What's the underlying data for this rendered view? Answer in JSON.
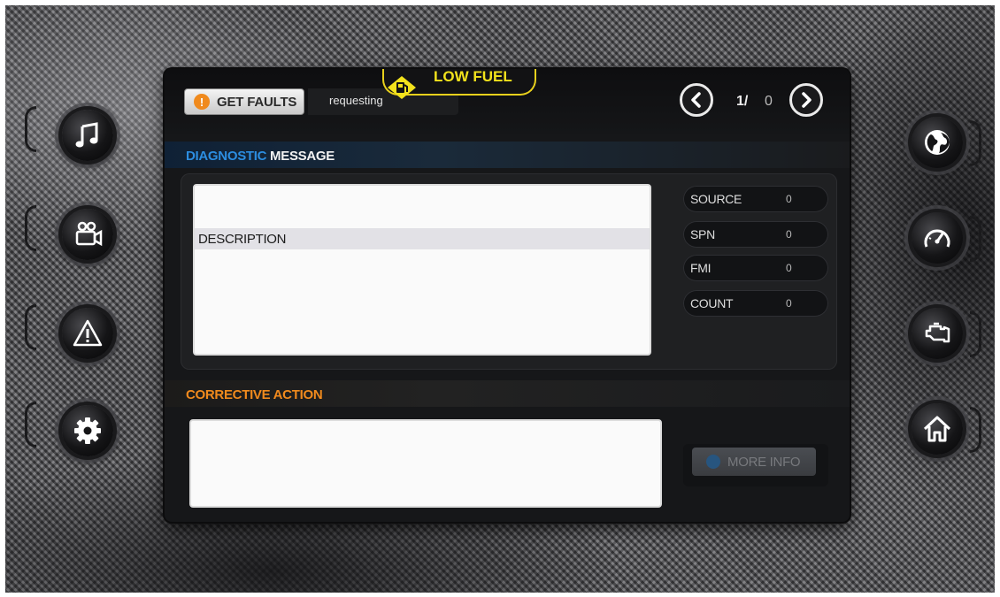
{
  "header": {
    "get_faults_label": "GET FAULTS",
    "status_text": "requesting",
    "alert_text": "LOW FUEL",
    "page_current": "1/",
    "page_total": "0"
  },
  "diagnostic": {
    "title_accent": "DIAGNOSTIC",
    "title_rest": " MESSAGE",
    "description_label": "DESCRIPTION",
    "stats": [
      {
        "label": "SOURCE",
        "value": "0"
      },
      {
        "label": "SPN",
        "value": "0"
      },
      {
        "label": "FMI",
        "value": "0"
      },
      {
        "label": "COUNT",
        "value": "0"
      }
    ]
  },
  "corrective": {
    "title": "CORRECTIVE ACTION",
    "more_info_label": "MORE INFO"
  },
  "icons": {
    "left": [
      "music-icon",
      "video-camera-icon",
      "warning-icon",
      "settings-gear-icon"
    ],
    "right": [
      "globe-icon",
      "speedometer-icon",
      "engine-icon",
      "home-icon"
    ]
  },
  "colors": {
    "diagnostic_accent": "#2c8de0",
    "corrective_accent": "#f08a1d",
    "alert_yellow": "#f2e21c"
  }
}
